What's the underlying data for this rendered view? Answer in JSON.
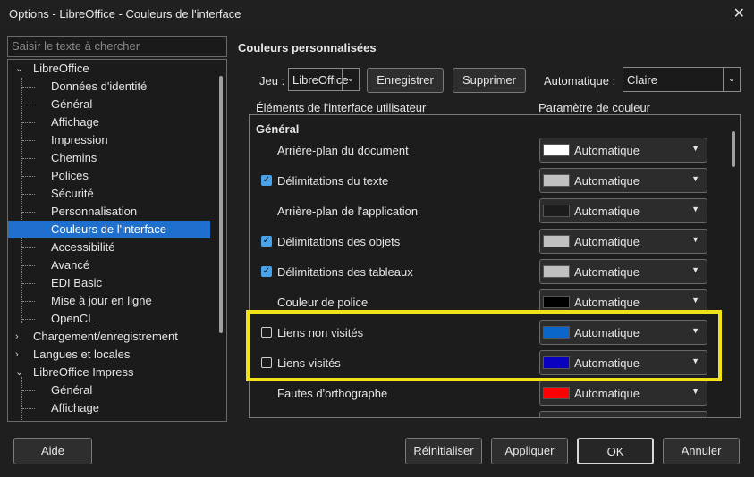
{
  "window": {
    "title": "Options - LibreOffice - Couleurs de l'interface",
    "close_icon": "close-icon"
  },
  "search": {
    "placeholder": "Saisir le texte à chercher",
    "value": ""
  },
  "tree": {
    "libreoffice": "LibreOffice",
    "items": [
      "Données d'identité",
      "Général",
      "Affichage",
      "Impression",
      "Chemins",
      "Polices",
      "Sécurité",
      "Personnalisation",
      "Couleurs de l'interface",
      "Accessibilité",
      "Avancé",
      "EDI Basic",
      "Mise à jour en ligne",
      "OpenCL"
    ],
    "selected": "Couleurs de l'interface",
    "chargement": "Chargement/enregistrement",
    "langues": "Langues et locales",
    "impress": "LibreOffice Impress",
    "impress_items": [
      "Général",
      "Affichage"
    ],
    "expanded_icon": "chevron-down-icon",
    "collapsed_icon": "chevron-right-icon"
  },
  "section": {
    "title": "Couleurs personnalisées",
    "jeu_label": "Jeu :",
    "jeu_value": "LibreOffice",
    "save_label": "Enregistrer",
    "delete_label": "Supprimer",
    "auto_label": "Automatique :",
    "auto_value": "Claire",
    "col_elements": "Éléments de l'interface utilisateur",
    "col_param": "Paramètre de couleur"
  },
  "panel": {
    "group": "Général",
    "rows": [
      {
        "label": "Arrière-plan du document",
        "checkbox": null,
        "swatch": "#ffffff",
        "value": "Automatique"
      },
      {
        "label": "Délimitations du texte",
        "checkbox": true,
        "swatch": "#c0c0c0",
        "value": "Automatique"
      },
      {
        "label": "Arrière-plan de l'application",
        "checkbox": null,
        "swatch": "#1c1c1c",
        "value": "Automatique"
      },
      {
        "label": "Délimitations des objets",
        "checkbox": true,
        "swatch": "#c0c0c0",
        "value": "Automatique"
      },
      {
        "label": "Délimitations des tableaux",
        "checkbox": true,
        "swatch": "#c0c0c0",
        "value": "Automatique"
      },
      {
        "label": "Couleur de police",
        "checkbox": null,
        "swatch": "#000000",
        "value": "Automatique"
      },
      {
        "label": "Liens non visités",
        "checkbox": false,
        "swatch": "#0b66c9",
        "value": "Automatique"
      },
      {
        "label": "Liens visités",
        "checkbox": false,
        "swatch": "#0a00c0",
        "value": "Automatique"
      },
      {
        "label": "Fautes d'orthographe",
        "checkbox": null,
        "swatch": "#ff0000",
        "value": "Automatique"
      }
    ]
  },
  "footer": {
    "help": "Aide",
    "reset": "Réinitialiser",
    "apply": "Appliquer",
    "ok": "OK",
    "cancel": "Annuler"
  },
  "colors": {
    "selection": "#1f6fcf",
    "highlight": "#f0e217",
    "checkbox": "#4aa3e8"
  }
}
